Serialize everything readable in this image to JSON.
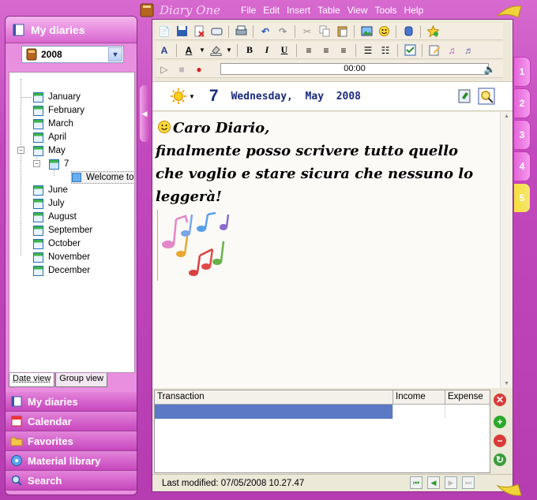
{
  "app": {
    "title": "Diary One"
  },
  "menu": [
    "File",
    "Edit",
    "Insert",
    "Table",
    "View",
    "Tools",
    "Help"
  ],
  "sidebar": {
    "title": "My diaries",
    "year": "2008",
    "tree": {
      "months": [
        "January",
        "February",
        "March",
        "April",
        "May",
        "June",
        "July",
        "August",
        "September",
        "October",
        "November",
        "December"
      ],
      "expanded_month": "May",
      "day": "7",
      "entry": "Welcome to"
    },
    "tabs": [
      "Date view",
      "Group view"
    ],
    "nav": [
      "My diaries",
      "Calendar",
      "Favorites",
      "Material library",
      "Search"
    ]
  },
  "player": {
    "time": "00:00"
  },
  "datebar": {
    "day": "7",
    "weekday": "Wednesday,",
    "month": "May",
    "year": "2008"
  },
  "entry": {
    "line1": "Caro Diario,",
    "line2": "finalmente posso scrivere tutto quello",
    "line3": "che voglio e stare sicura che nessuno lo",
    "line4": "leggerà!"
  },
  "transactions": {
    "columns": [
      "Transaction",
      "Income",
      "Expense"
    ]
  },
  "status": {
    "last_modified": "Last modified: 07/05/2008 10.27.47"
  },
  "right_tabs": [
    "1",
    "2",
    "3",
    "4",
    "5"
  ],
  "right_tabs_active": "5",
  "colors": {
    "accent": "#c249bd",
    "title": "#1b2b7c",
    "active_tab": "#f6df3a"
  }
}
